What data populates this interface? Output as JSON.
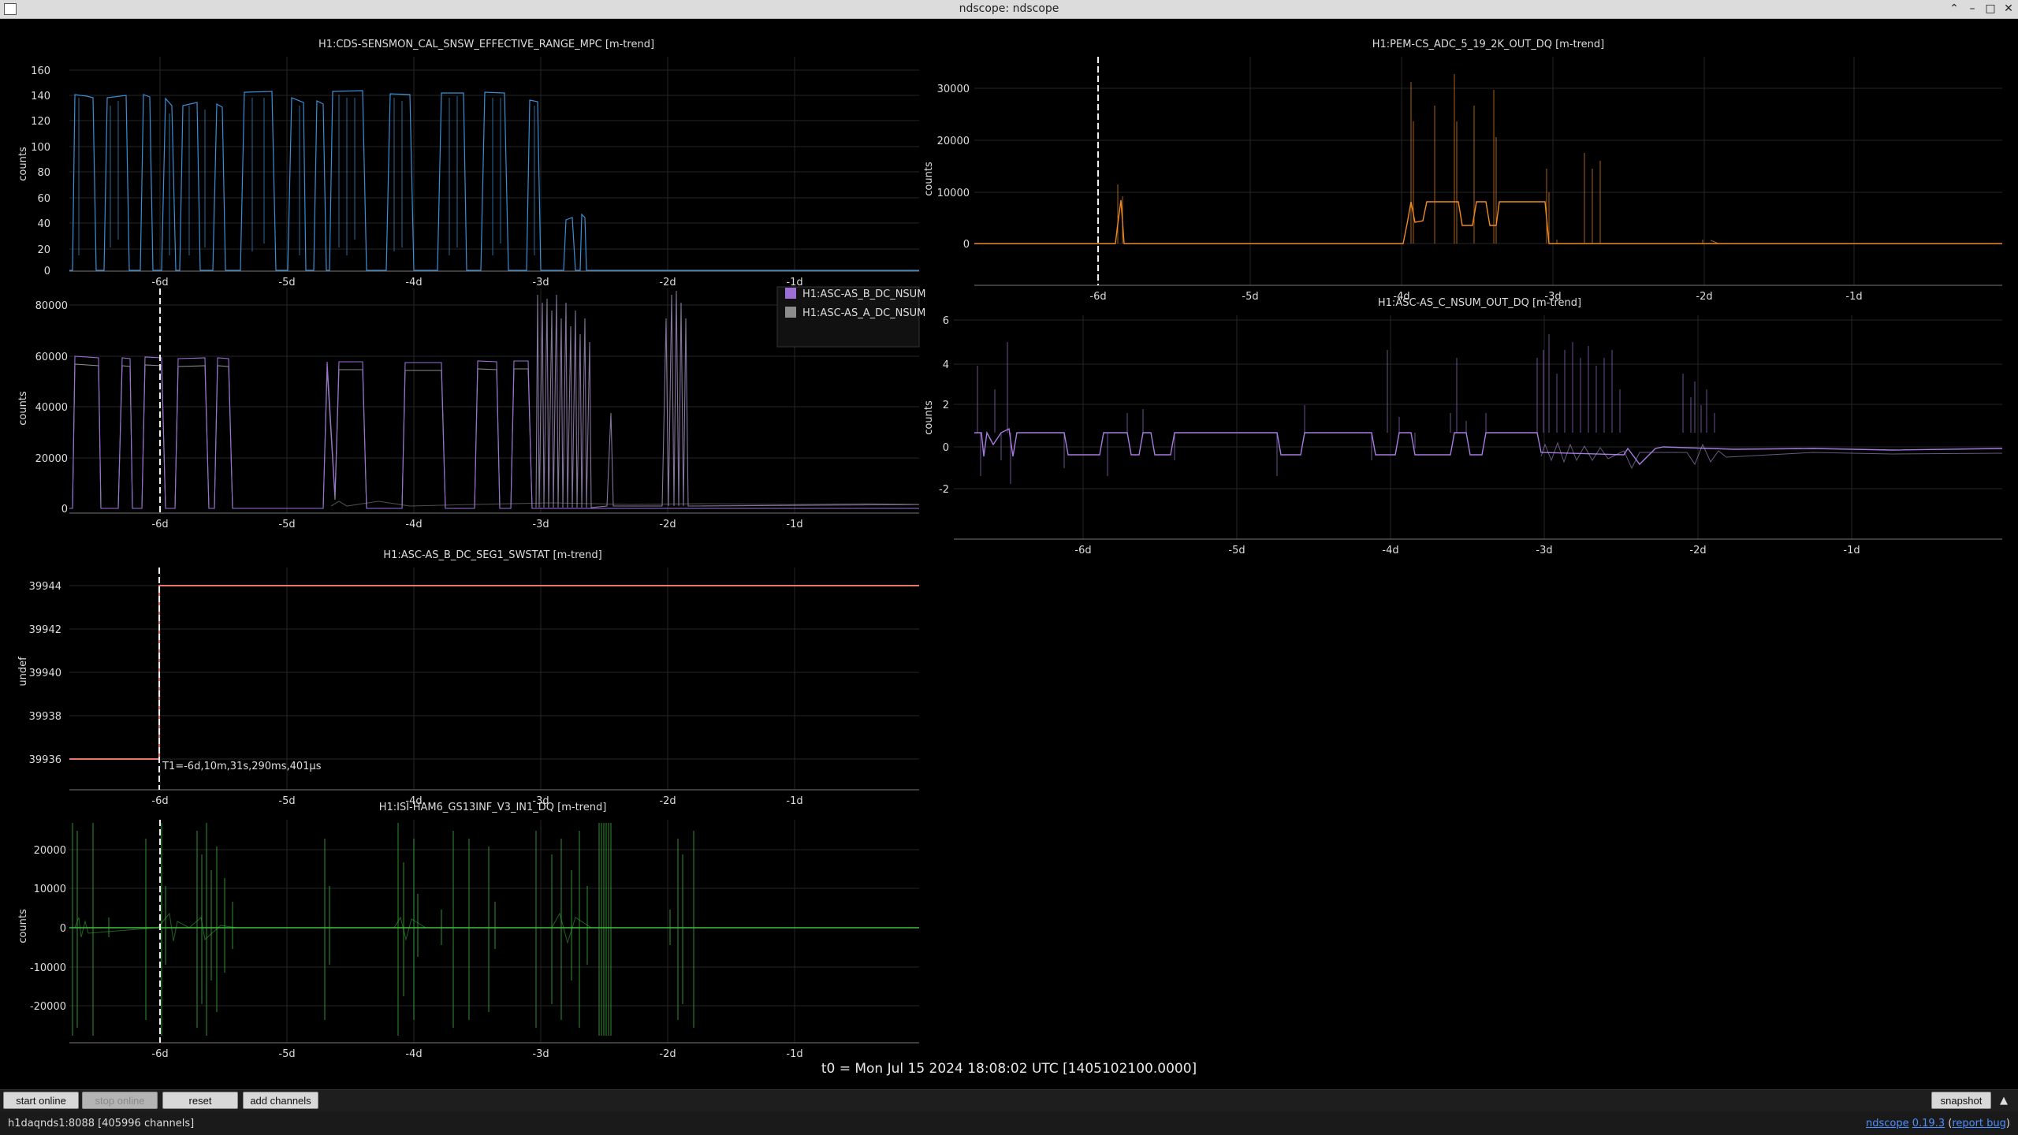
{
  "window": {
    "title": "ndscope: ndscope"
  },
  "plots": [
    {
      "title": "H1:CDS-SENSMON_CAL_SNSW_EFFECTIVE_RANGE_MPC [m-trend]",
      "ylabel": "counts",
      "yticks": [
        "160",
        "140",
        "120",
        "100",
        "80",
        "60",
        "40",
        "20",
        "0"
      ],
      "color": "#3a8fd8"
    },
    {
      "title": "",
      "ylabel": "counts",
      "yticks": [
        "80000",
        "60000",
        "40000",
        "20000",
        "0"
      ],
      "legend": [
        {
          "name": "H1:ASC-AS_B_DC_NSUM",
          "color": "#9b6fd6"
        },
        {
          "name": "H1:ASC-AS_A_DC_NSUM",
          "color": "#8c8c8c"
        }
      ]
    },
    {
      "title": "H1:ASC-AS_B_DC_SEG1_SWSTAT [m-trend]",
      "ylabel": "undef",
      "yticks": [
        "39944",
        "39942",
        "39940",
        "39938",
        "39936"
      ],
      "color": "#e8766a",
      "cursor_label": "T1=-6d,10m,31s,290ms,401μs"
    },
    {
      "title": "H1:ISI-HAM6_GS13INF_V3_IN1_DQ [m-trend]",
      "ylabel": "counts",
      "yticks": [
        "20000",
        "10000",
        "0",
        "-10000",
        "-20000"
      ],
      "color": "#3fc23f"
    },
    {
      "title": "H1:PEM-CS_ADC_5_19_2K_OUT_DQ [m-trend]",
      "ylabel": "counts",
      "yticks": [
        "30000",
        "20000",
        "10000",
        "0"
      ],
      "color": "#f08a24"
    },
    {
      "title": "H1:ASC-AS_C_NSUM_OUT_DQ [m-trend]",
      "ylabel": "counts",
      "yticks": [
        "6",
        "4",
        "2",
        "0",
        "-2"
      ],
      "color": "#a77be0"
    }
  ],
  "xticks": [
    "-6d",
    "-5d",
    "-4d",
    "-3d",
    "-2d",
    "-1d"
  ],
  "t0_label": "t0 = Mon Jul 15 2024 18:08:02 UTC [1405102100.0000]",
  "toolbar": {
    "start_online": "start online",
    "stop_online": "stop online",
    "reset": "reset",
    "add_channels": "add channels",
    "snapshot": "snapshot"
  },
  "status": {
    "server": "h1daqnds1:8088  [405996 channels]",
    "app_name": "ndscope",
    "version": "0.19.3",
    "report_bug": "report bug"
  }
}
